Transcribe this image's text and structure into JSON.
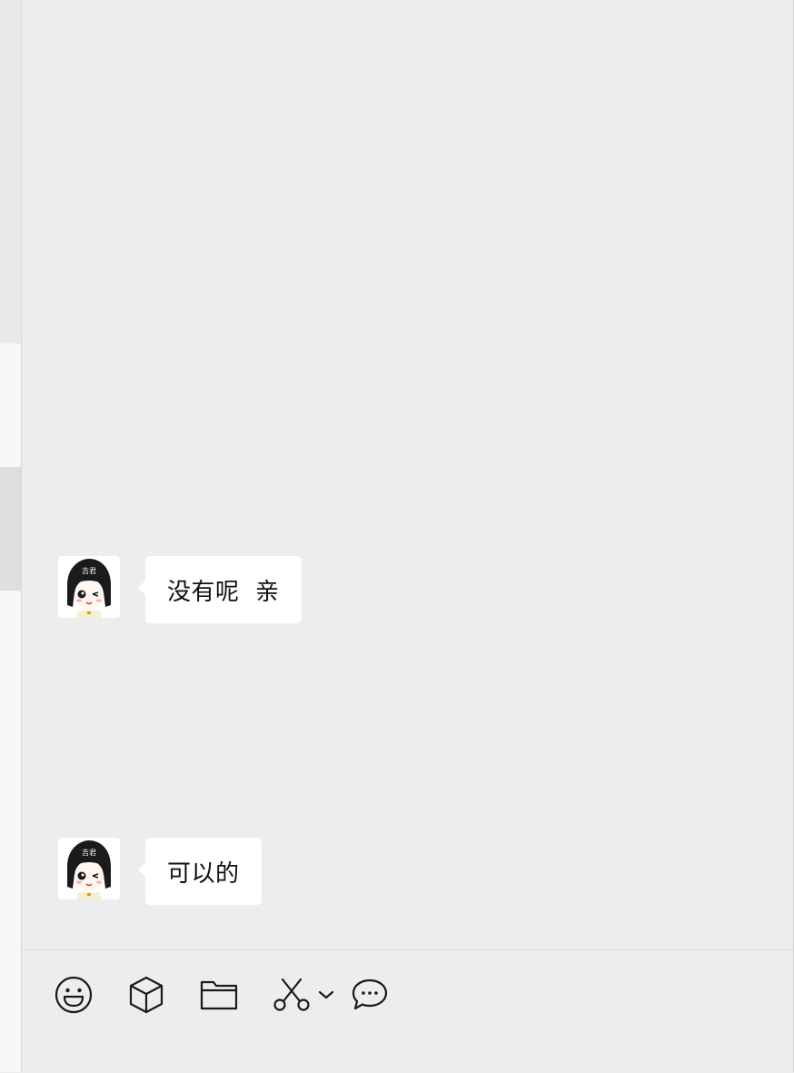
{
  "chat": {
    "messages": [
      {
        "text": "没有呢  亲"
      },
      {
        "text": "可以的"
      }
    ]
  },
  "toolbar": {
    "icons": [
      "emoji-icon",
      "package-icon",
      "folder-icon",
      "scissors-icon",
      "chevron-down-icon",
      "chat-bubble-icon"
    ]
  },
  "colors": {
    "chat_background": "#ededed",
    "bubble": "#ffffff",
    "text": "#111111",
    "icon": "#1a1a1a"
  }
}
